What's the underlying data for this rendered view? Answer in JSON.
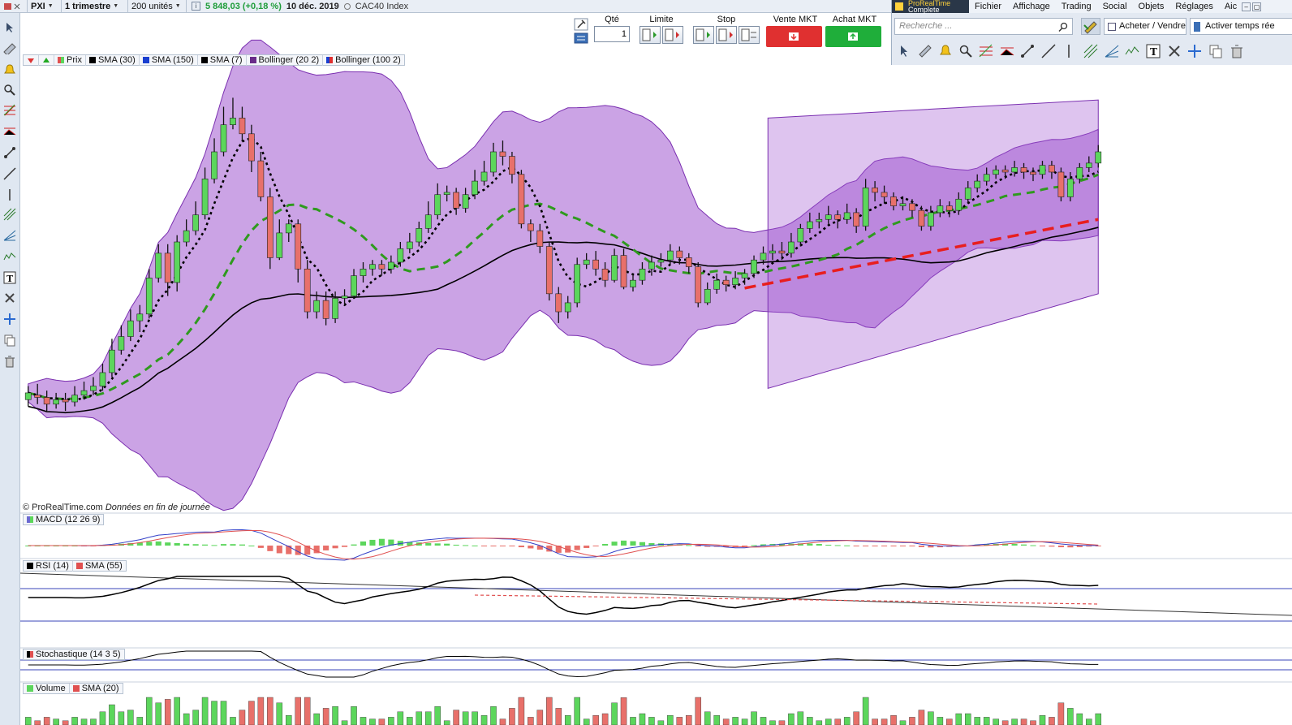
{
  "toolbar": {
    "symbol": "PXI",
    "period": "1 trimestre",
    "units": "200 unités",
    "info_icon": "info-icon",
    "quote_value": "5 848,03 (+0,18 %)",
    "quote_date": "10 déc. 2019",
    "index_name": "CAC40 Index"
  },
  "order_panel": {
    "qty_label": "Qté",
    "qty_value": "1",
    "limit_label": "Limite",
    "stop_label": "Stop",
    "sell_label": "Vente MKT",
    "buy_label": "Achat MKT",
    "sell_color": "#e03030",
    "buy_color": "#1fae3a"
  },
  "right_panel": {
    "logo_top": "ProRealTime",
    "logo_bottom": "Complete",
    "menu": [
      "Fichier",
      "Affichage",
      "Trading",
      "Social",
      "Objets",
      "Réglages",
      "Aic"
    ],
    "search_placeholder": "Recherche ...",
    "buy_sell_label": "Acheter / Vendre",
    "realtime_label": "Activer temps rée"
  },
  "price_legend": [
    "Prix",
    "SMA (30)",
    "SMA (150)",
    "SMA (7)",
    "Bollinger (20 2)",
    "Bollinger (100 2)"
  ],
  "price_legend_colors": [
    "#e05050",
    "#000000",
    "#1a3fd0",
    "#000000",
    "#6a2c8a",
    "#6a2c8a"
  ],
  "watermark": {
    "site": "© ProRealTime.com",
    "note": "Données en fin de journée"
  },
  "panels": {
    "macd": "MACD (12 26 9)",
    "rsi": "RSI (14)",
    "rsi_sma": "SMA (55)",
    "stoch": "Stochastique (14 3 5)",
    "volume": "Volume",
    "volume_sma": "SMA (20)"
  },
  "colors": {
    "up": "#5cd65c",
    "down": "#e8706a",
    "band": "#a057d0",
    "sma7": "#000000",
    "sma30": "#2f9a1e",
    "sma150": "#000000",
    "trend": "#e81e1e"
  },
  "chart_data": {
    "type": "candlestick",
    "candles": [
      [
        5500,
        5530,
        5560,
        5470
      ],
      [
        5520,
        5510,
        5570,
        5480
      ],
      [
        5510,
        5480,
        5540,
        5450
      ],
      [
        5480,
        5500,
        5530,
        5460
      ],
      [
        5500,
        5490,
        5530,
        5450
      ],
      [
        5490,
        5520,
        5560,
        5470
      ],
      [
        5520,
        5540,
        5580,
        5500
      ],
      [
        5540,
        5560,
        5600,
        5520
      ],
      [
        5560,
        5620,
        5660,
        5540
      ],
      [
        5620,
        5720,
        5770,
        5600
      ],
      [
        5720,
        5780,
        5830,
        5700
      ],
      [
        5780,
        5850,
        5900,
        5760
      ],
      [
        5850,
        5880,
        5920,
        5800
      ],
      [
        5880,
        6040,
        6080,
        5860
      ],
      [
        6040,
        6150,
        6190,
        6020
      ],
      [
        6150,
        6020,
        6190,
        5960
      ],
      [
        6020,
        6200,
        6230,
        5980
      ],
      [
        6200,
        6250,
        6300,
        6180
      ],
      [
        6250,
        6320,
        6380,
        6230
      ],
      [
        6320,
        6480,
        6530,
        6300
      ],
      [
        6480,
        6600,
        6660,
        6460
      ],
      [
        6600,
        6720,
        6800,
        6580
      ],
      [
        6720,
        6750,
        6840,
        6700
      ],
      [
        6750,
        6680,
        6800,
        6650
      ],
      [
        6680,
        6560,
        6720,
        6510
      ],
      [
        6560,
        6400,
        6600,
        6380
      ],
      [
        6400,
        6130,
        6440,
        6080
      ],
      [
        6130,
        6240,
        6300,
        6120
      ],
      [
        6240,
        6280,
        6300,
        6200
      ],
      [
        6280,
        6080,
        6300,
        6020
      ],
      [
        6080,
        5890,
        6120,
        5860
      ],
      [
        5890,
        5940,
        5980,
        5860
      ],
      [
        5940,
        5860,
        5980,
        5830
      ],
      [
        5860,
        5950,
        5980,
        5840
      ],
      [
        5950,
        5960,
        5990,
        5920
      ],
      [
        5960,
        6050,
        6080,
        5950
      ],
      [
        6050,
        6080,
        6110,
        6020
      ],
      [
        6080,
        6100,
        6120,
        6050
      ],
      [
        6100,
        6080,
        6120,
        6050
      ],
      [
        6080,
        6110,
        6140,
        6060
      ],
      [
        6110,
        6170,
        6200,
        6090
      ],
      [
        6170,
        6200,
        6240,
        6150
      ],
      [
        6200,
        6260,
        6290,
        6180
      ],
      [
        6260,
        6320,
        6380,
        6240
      ],
      [
        6320,
        6410,
        6460,
        6300
      ],
      [
        6410,
        6420,
        6450,
        6380
      ],
      [
        6420,
        6350,
        6440,
        6320
      ],
      [
        6350,
        6410,
        6440,
        6330
      ],
      [
        6410,
        6470,
        6520,
        6390
      ],
      [
        6470,
        6510,
        6560,
        6450
      ],
      [
        6510,
        6600,
        6640,
        6490
      ],
      [
        6600,
        6580,
        6650,
        6540
      ],
      [
        6580,
        6500,
        6600,
        6460
      ],
      [
        6500,
        6280,
        6520,
        6260
      ],
      [
        6280,
        6250,
        6300,
        6200
      ],
      [
        6250,
        6180,
        6280,
        6150
      ],
      [
        6180,
        5970,
        6200,
        5940
      ],
      [
        5970,
        5890,
        6000,
        5840
      ],
      [
        5890,
        5930,
        5960,
        5860
      ],
      [
        5930,
        6100,
        6130,
        5910
      ],
      [
        6100,
        6120,
        6150,
        6080
      ],
      [
        6120,
        6080,
        6160,
        6050
      ],
      [
        6080,
        6030,
        6110,
        6000
      ],
      [
        6030,
        6140,
        6170,
        6020
      ],
      [
        6140,
        6000,
        6170,
        5990
      ],
      [
        6000,
        6030,
        6060,
        5980
      ],
      [
        6030,
        6080,
        6110,
        6010
      ],
      [
        6080,
        6110,
        6140,
        6050
      ],
      [
        6110,
        6120,
        6150,
        6090
      ],
      [
        6120,
        6160,
        6190,
        6100
      ],
      [
        6160,
        6130,
        6180,
        6100
      ],
      [
        6130,
        6090,
        6150,
        6060
      ],
      [
        6090,
        5930,
        6110,
        5910
      ],
      [
        5930,
        5990,
        6020,
        5920
      ],
      [
        5990,
        6030,
        6060,
        5970
      ],
      [
        6030,
        6010,
        6050,
        5980
      ],
      [
        6010,
        6040,
        6070,
        5990
      ],
      [
        6040,
        6060,
        6080,
        6010
      ],
      [
        6060,
        6120,
        6140,
        6040
      ],
      [
        6120,
        6150,
        6180,
        6100
      ],
      [
        6150,
        6160,
        6190,
        6120
      ],
      [
        6160,
        6150,
        6200,
        6120
      ],
      [
        6150,
        6200,
        6240,
        6130
      ],
      [
        6200,
        6260,
        6280,
        6180
      ],
      [
        6260,
        6290,
        6330,
        6240
      ],
      [
        6290,
        6300,
        6330,
        6260
      ],
      [
        6300,
        6320,
        6360,
        6280
      ],
      [
        6320,
        6300,
        6340,
        6260
      ],
      [
        6300,
        6330,
        6370,
        6280
      ],
      [
        6330,
        6270,
        6350,
        6240
      ],
      [
        6270,
        6440,
        6480,
        6250
      ],
      [
        6440,
        6420,
        6470,
        6380
      ],
      [
        6420,
        6400,
        6450,
        6370
      ],
      [
        6400,
        6360,
        6420,
        6340
      ],
      [
        6360,
        6370,
        6400,
        6340
      ],
      [
        6370,
        6340,
        6390,
        6310
      ],
      [
        6340,
        6270,
        6360,
        6250
      ],
      [
        6270,
        6330,
        6360,
        6250
      ],
      [
        6330,
        6360,
        6390,
        6310
      ],
      [
        6360,
        6340,
        6380,
        6310
      ],
      [
        6340,
        6390,
        6420,
        6320
      ],
      [
        6390,
        6440,
        6470,
        6370
      ],
      [
        6440,
        6470,
        6500,
        6420
      ],
      [
        6470,
        6500,
        6530,
        6450
      ],
      [
        6500,
        6520,
        6540,
        6480
      ],
      [
        6520,
        6510,
        6540,
        6480
      ],
      [
        6510,
        6530,
        6560,
        6490
      ],
      [
        6530,
        6510,
        6550,
        6480
      ],
      [
        6510,
        6500,
        6530,
        6470
      ],
      [
        6500,
        6540,
        6560,
        6480
      ],
      [
        6540,
        6510,
        6560,
        6480
      ],
      [
        6510,
        6400,
        6530,
        6380
      ],
      [
        6400,
        6480,
        6510,
        6380
      ],
      [
        6480,
        6530,
        6550,
        6460
      ],
      [
        6530,
        6550,
        6580,
        6510
      ],
      [
        6550,
        6600,
        6630,
        6530
      ]
    ],
    "y_range": [
      5000,
      7000
    ]
  }
}
